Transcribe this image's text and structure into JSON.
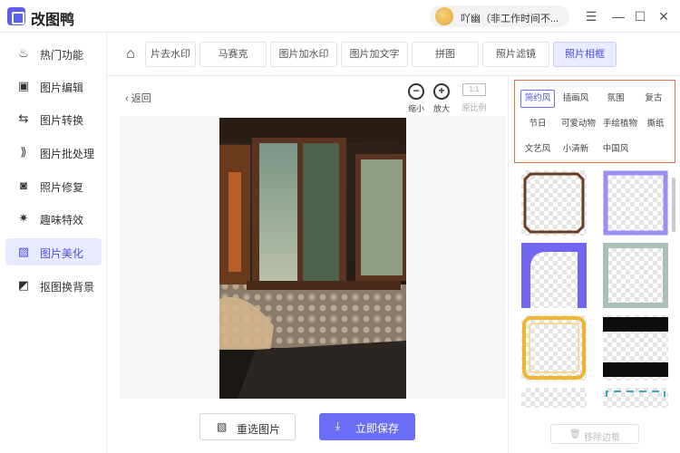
{
  "app": {
    "title": "改图鸭",
    "user_name": "吖幽（非工作时间不..."
  },
  "window_controls": {
    "menu": "☰",
    "minimize": "—",
    "maximize": "☐",
    "close": "✕"
  },
  "sidebar": {
    "items": [
      {
        "label": "热门功能",
        "icon": "fire-icon",
        "glyph": "♨"
      },
      {
        "label": "图片编辑",
        "icon": "image-edit-icon",
        "glyph": "▣"
      },
      {
        "label": "图片转换",
        "icon": "convert-icon",
        "glyph": "⇆"
      },
      {
        "label": "图片批处理",
        "icon": "batch-icon",
        "glyph": "⟫"
      },
      {
        "label": "照片修复",
        "icon": "repair-icon",
        "glyph": "◙"
      },
      {
        "label": "趣味特效",
        "icon": "sparkle-icon",
        "glyph": "✷"
      },
      {
        "label": "图片美化",
        "icon": "beautify-icon",
        "glyph": "▨"
      },
      {
        "label": "抠图换背景",
        "icon": "cutout-icon",
        "glyph": "◩"
      }
    ],
    "active_index": 6
  },
  "toolbar": {
    "home_glyph": "⌂",
    "tabs": [
      "片去水印",
      "马赛克",
      "图片加水印",
      "图片加文字",
      "拼图",
      "照片滤镜",
      "照片相框"
    ],
    "active_index": 6
  },
  "main": {
    "back_label": "返回",
    "zoom_out_label": "缩小",
    "zoom_in_label": "放大",
    "ratio_box": "1:1",
    "ratio_label": "原比例",
    "reselect_label": "重选图片",
    "save_label": "立即保存"
  },
  "frame_panel": {
    "styles": [
      "简约风",
      "插画风",
      "氛围",
      "复古",
      "节日",
      "可爱动物",
      "手绘植物",
      "撕纸",
      "文艺风",
      "小清新",
      "中国风"
    ],
    "active_style": 0,
    "remove_label": "移除边框"
  },
  "colors": {
    "accent": "#6a6ef5",
    "highlight_border": "#e8734a",
    "active_bg": "#e8eaff"
  }
}
